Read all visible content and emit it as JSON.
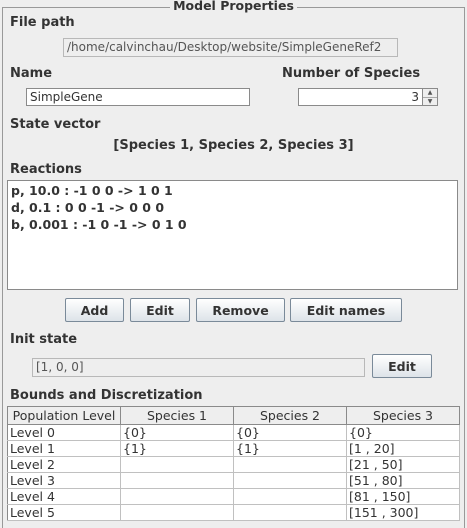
{
  "frame": {
    "title": "Model Properties"
  },
  "file_path": {
    "label": "File path",
    "value": "/home/calvinchau/Desktop/website/SimpleGeneRef2"
  },
  "name": {
    "label": "Name",
    "value": "SimpleGene"
  },
  "num_species": {
    "label": "Number of Species",
    "value": "3"
  },
  "state_vector": {
    "label": "State vector",
    "value": "[Species 1, Species 2, Species 3]"
  },
  "reactions": {
    "label": "Reactions",
    "items": [
      "p, 10.0 : -1 0 0 -> 1 0 1",
      "d, 0.1 : 0 0 -1 -> 0 0 0",
      "b, 0.001 : -1 0 -1 -> 0 1 0"
    ],
    "buttons": {
      "add": "Add",
      "edit": "Edit",
      "remove": "Remove",
      "edit_names": "Edit names"
    }
  },
  "init_state": {
    "label": "Init state",
    "value": "[1, 0, 0]",
    "edit": "Edit"
  },
  "bounds": {
    "label": "Bounds and Discretization",
    "columns": [
      "Population Level",
      "Species 1",
      "Species 2",
      "Species 3"
    ],
    "rows": [
      [
        "Level 0",
        "{0}",
        "{0}",
        "{0}"
      ],
      [
        "Level 1",
        "{1}",
        "{1}",
        "[1 , 20]"
      ],
      [
        "Level 2",
        "",
        "",
        "[21 , 50]"
      ],
      [
        "Level 3",
        "",
        "",
        "[51 , 80]"
      ],
      [
        "Level 4",
        "",
        "",
        "[81 , 150]"
      ],
      [
        "Level 5",
        "",
        "",
        "[151 , 300]"
      ]
    ]
  }
}
